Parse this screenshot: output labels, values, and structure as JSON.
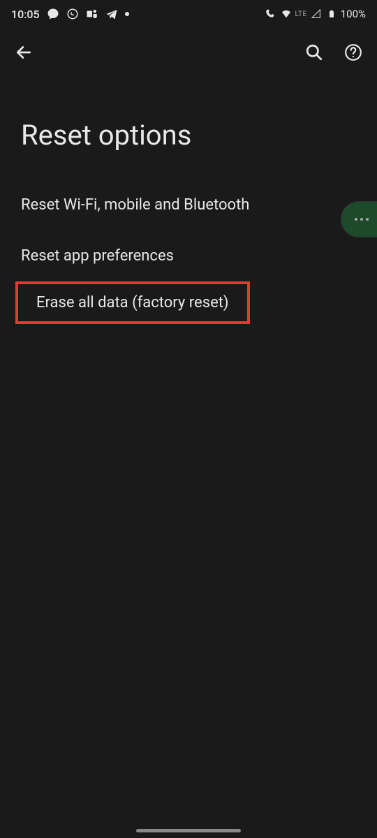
{
  "statusBar": {
    "time": "10:05",
    "networkLabel": "LTE",
    "battery": "100%"
  },
  "page": {
    "title": "Reset options"
  },
  "options": [
    {
      "label": "Reset Wi-Fi, mobile and Bluetooth"
    },
    {
      "label": "Reset app preferences"
    },
    {
      "label": "Erase all data (factory reset)"
    }
  ]
}
